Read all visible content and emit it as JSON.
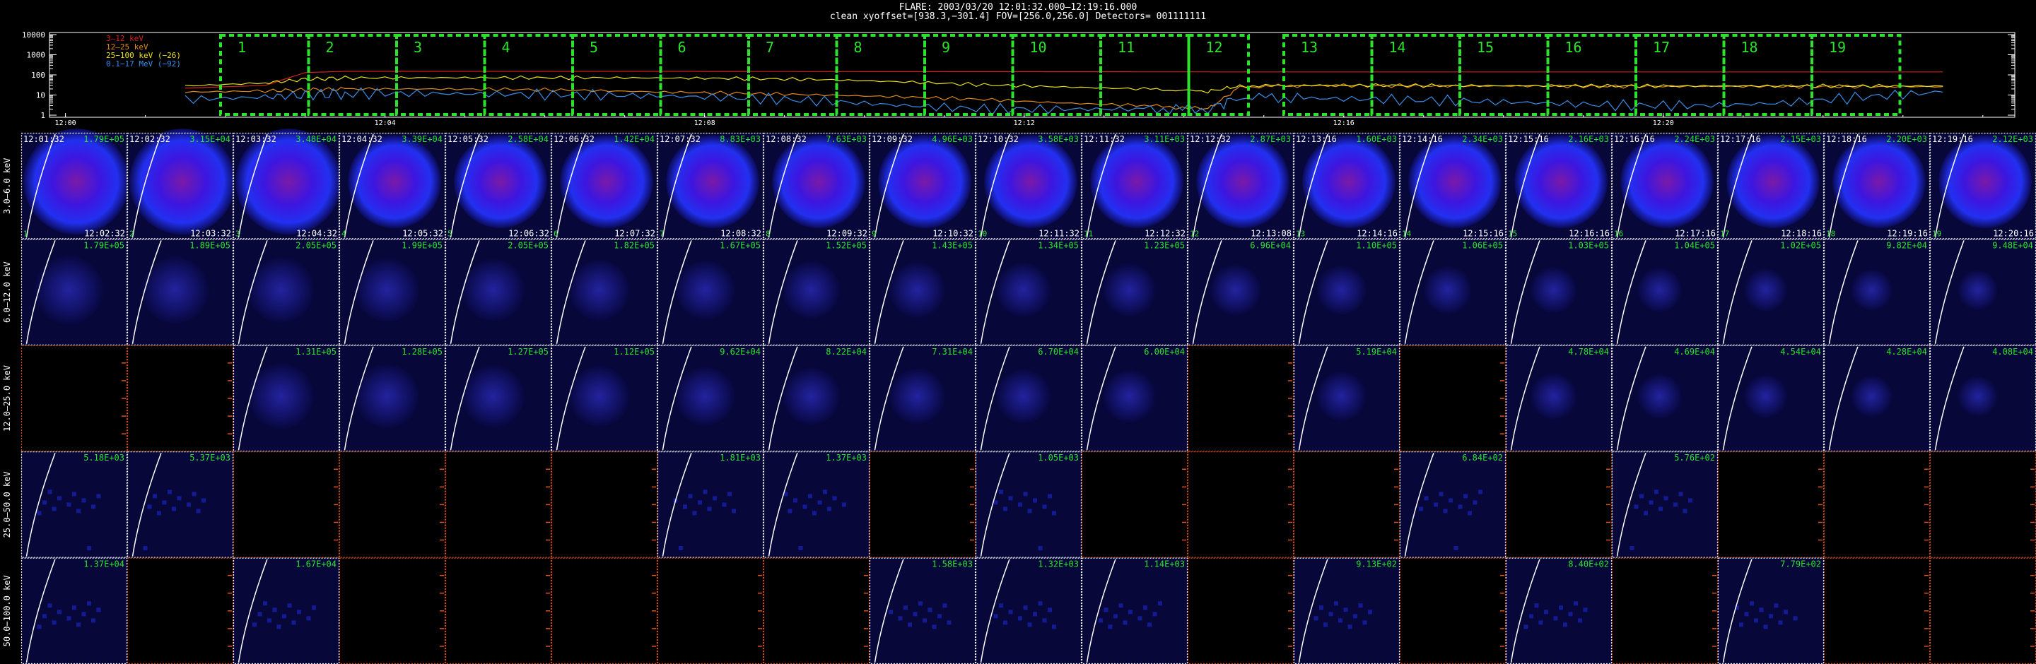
{
  "header": {
    "line1": "FLARE: 2003/03/20 12:01:32.000–12:19:16.000",
    "line2": "clean    xyoffset=[938.3,−301.4]   FOV=[256.0,256.0]   Detectors= 001111111"
  },
  "colors": {
    "band_3_12": "#d42020",
    "band_12_25": "#e08a1a",
    "band_25_100": "#e6e020",
    "band_mev": "#3a8de8",
    "interval_box": "#2ce32c",
    "panel_border": "#ffffff",
    "empty_border": "#e0501c",
    "image_label": "#2ce32c",
    "limb": "#ffffff"
  },
  "chart_data": [
    {
      "type": "line",
      "title": "",
      "ylabel": "",
      "y_scale": "log",
      "ylim": [
        1,
        10000
      ],
      "y_ticks": [
        "1",
        "10",
        "100",
        "1000",
        "10000"
      ],
      "x_ticks": [
        "12:00",
        "12:04",
        "12:08",
        "12:12",
        "12:16",
        "12:20"
      ],
      "legend": {
        "position": "top-left",
        "entries": [
          "3–12 keV",
          "12–25 keV",
          "25−100 keV (−26)",
          "0.1−17 MeV (−92)"
        ]
      },
      "x_minutes": [
        0.0,
        1.0,
        1.5,
        2.0,
        3.0,
        4.0,
        5.0,
        6.0,
        7.0,
        8.0,
        9.0,
        10.0,
        11.0,
        12.0,
        12.8,
        13.2,
        14.0,
        15.0,
        16.0,
        17.0,
        18.0,
        19.0,
        20.0,
        21.0,
        22.0
      ],
      "series": [
        {
          "name": "3–12 keV",
          "values": [
            22,
            30,
            130,
            150,
            150,
            150,
            150,
            150,
            148,
            146,
            145,
            144,
            143,
            142,
            141,
            140,
            140,
            140,
            140,
            140,
            140,
            140,
            140,
            140,
            140
          ]
        },
        {
          "name": "12–25 keV",
          "values": [
            14,
            16,
            18,
            20,
            20,
            19,
            17,
            14,
            12,
            10,
            8,
            6,
            4,
            3,
            2,
            25,
            30,
            29,
            28,
            28,
            27,
            27,
            27,
            26,
            26
          ]
        },
        {
          "name": "25−100 keV (−26)",
          "values": [
            28,
            40,
            60,
            70,
            72,
            72,
            72,
            70,
            66,
            58,
            45,
            32,
            25,
            20,
            15,
            28,
            30,
            30,
            29,
            29,
            28,
            28,
            28,
            28,
            28
          ]
        },
        {
          "name": "0.1−17 MeV (−92)",
          "values": [
            6,
            8,
            10,
            12,
            12,
            11,
            10,
            9,
            7,
            5,
            3,
            2,
            2,
            2,
            2,
            8,
            7,
            6,
            5,
            4,
            3,
            3,
            4,
            8,
            14
          ]
        }
      ],
      "intervals": [
        "1",
        "2",
        "3",
        "4",
        "5",
        "6",
        "7",
        "8",
        "9",
        "10",
        "11",
        "12",
        "13",
        "14",
        "15",
        "16",
        "17",
        "18",
        "19"
      ]
    },
    {
      "type": "image_grid",
      "row_labels": [
        "3.0–6.0 keV",
        "6.0–12.0 keV",
        "12.0–25.0 keV",
        "25.0–50.0 keV",
        "50.0−100.0 keV"
      ],
      "columns": [
        {
          "index": "1",
          "start": "12:01:32",
          "end": "12:02:32"
        },
        {
          "index": "2",
          "start": "12:02:32",
          "end": "12:03:32"
        },
        {
          "index": "3",
          "start": "12:03:32",
          "end": "12:04:32"
        },
        {
          "index": "4",
          "start": "12:04:32",
          "end": "12:05:32"
        },
        {
          "index": "5",
          "start": "12:05:32",
          "end": "12:06:32"
        },
        {
          "index": "6",
          "start": "12:06:32",
          "end": "12:07:32"
        },
        {
          "index": "7",
          "start": "12:07:32",
          "end": "12:08:32"
        },
        {
          "index": "8",
          "start": "12:08:32",
          "end": "12:09:32"
        },
        {
          "index": "9",
          "start": "12:09:32",
          "end": "12:10:32"
        },
        {
          "index": "10",
          "start": "12:10:32",
          "end": "12:11:32"
        },
        {
          "index": "11",
          "start": "12:11:32",
          "end": "12:12:32"
        },
        {
          "index": "12",
          "start": "12:12:32",
          "end": "12:13:08"
        },
        {
          "index": "13",
          "start": "12:13:16",
          "end": "12:14:16"
        },
        {
          "index": "14",
          "start": "12:14:16",
          "end": "12:15:16"
        },
        {
          "index": "15",
          "start": "12:15:16",
          "end": "12:16:16"
        },
        {
          "index": "16",
          "start": "12:16:16",
          "end": "12:17:16"
        },
        {
          "index": "17",
          "start": "12:17:16",
          "end": "12:18:16"
        },
        {
          "index": "18",
          "start": "12:18:16",
          "end": "12:19:16"
        },
        {
          "index": "19",
          "start": "12:19:16",
          "end": "12:20:16"
        }
      ],
      "peaks": [
        [
          "1.79E+05",
          "3.15E+04",
          "3.48E+04",
          "3.39E+04",
          "2.58E+04",
          "1.42E+04",
          "8.83E+03",
          "7.63E+03",
          "4.96E+03",
          "3.58E+03",
          "3.11E+03",
          "2.87E+03",
          "1.60E+03",
          "2.34E+03",
          "2.16E+03",
          "2.24E+03",
          "2.15E+03",
          "2.20E+03",
          "2.12E+03"
        ],
        [
          "1.79E+05",
          "1.89E+05",
          "2.05E+05",
          "1.99E+05",
          "2.05E+05",
          "1.82E+05",
          "1.67E+05",
          "1.52E+05",
          "1.43E+05",
          "1.34E+05",
          "1.23E+05",
          "6.96E+04",
          "1.10E+05",
          "1.06E+05",
          "1.03E+05",
          "1.04E+05",
          "1.02E+05",
          "9.82E+04",
          "9.48E+04"
        ],
        [
          "",
          "",
          "1.31E+05",
          "1.28E+05",
          "1.27E+05",
          "1.12E+05",
          "9.62E+04",
          "8.22E+04",
          "7.31E+04",
          "6.70E+04",
          "6.00E+04",
          "",
          "5.19E+04",
          "",
          "4.78E+04",
          "4.69E+04",
          "4.54E+04",
          "4.28E+04",
          "4.08E+04"
        ],
        [
          "5.18E+03",
          "5.37E+03",
          "",
          "",
          "",
          "",
          "1.81E+03",
          "1.37E+03",
          "",
          "1.05E+03",
          "",
          "",
          "",
          "6.84E+02",
          "",
          "5.76E+02",
          "",
          "",
          ""
        ],
        [
          "1.37E+04",
          "",
          "1.67E+04",
          "",
          "",
          "",
          "",
          "",
          "1.58E+03",
          "1.32E+03",
          "1.14E+03",
          "",
          "9.13E+02",
          "",
          "8.40E+02",
          "",
          "7.79E+02",
          "",
          ""
        ]
      ]
    }
  ]
}
